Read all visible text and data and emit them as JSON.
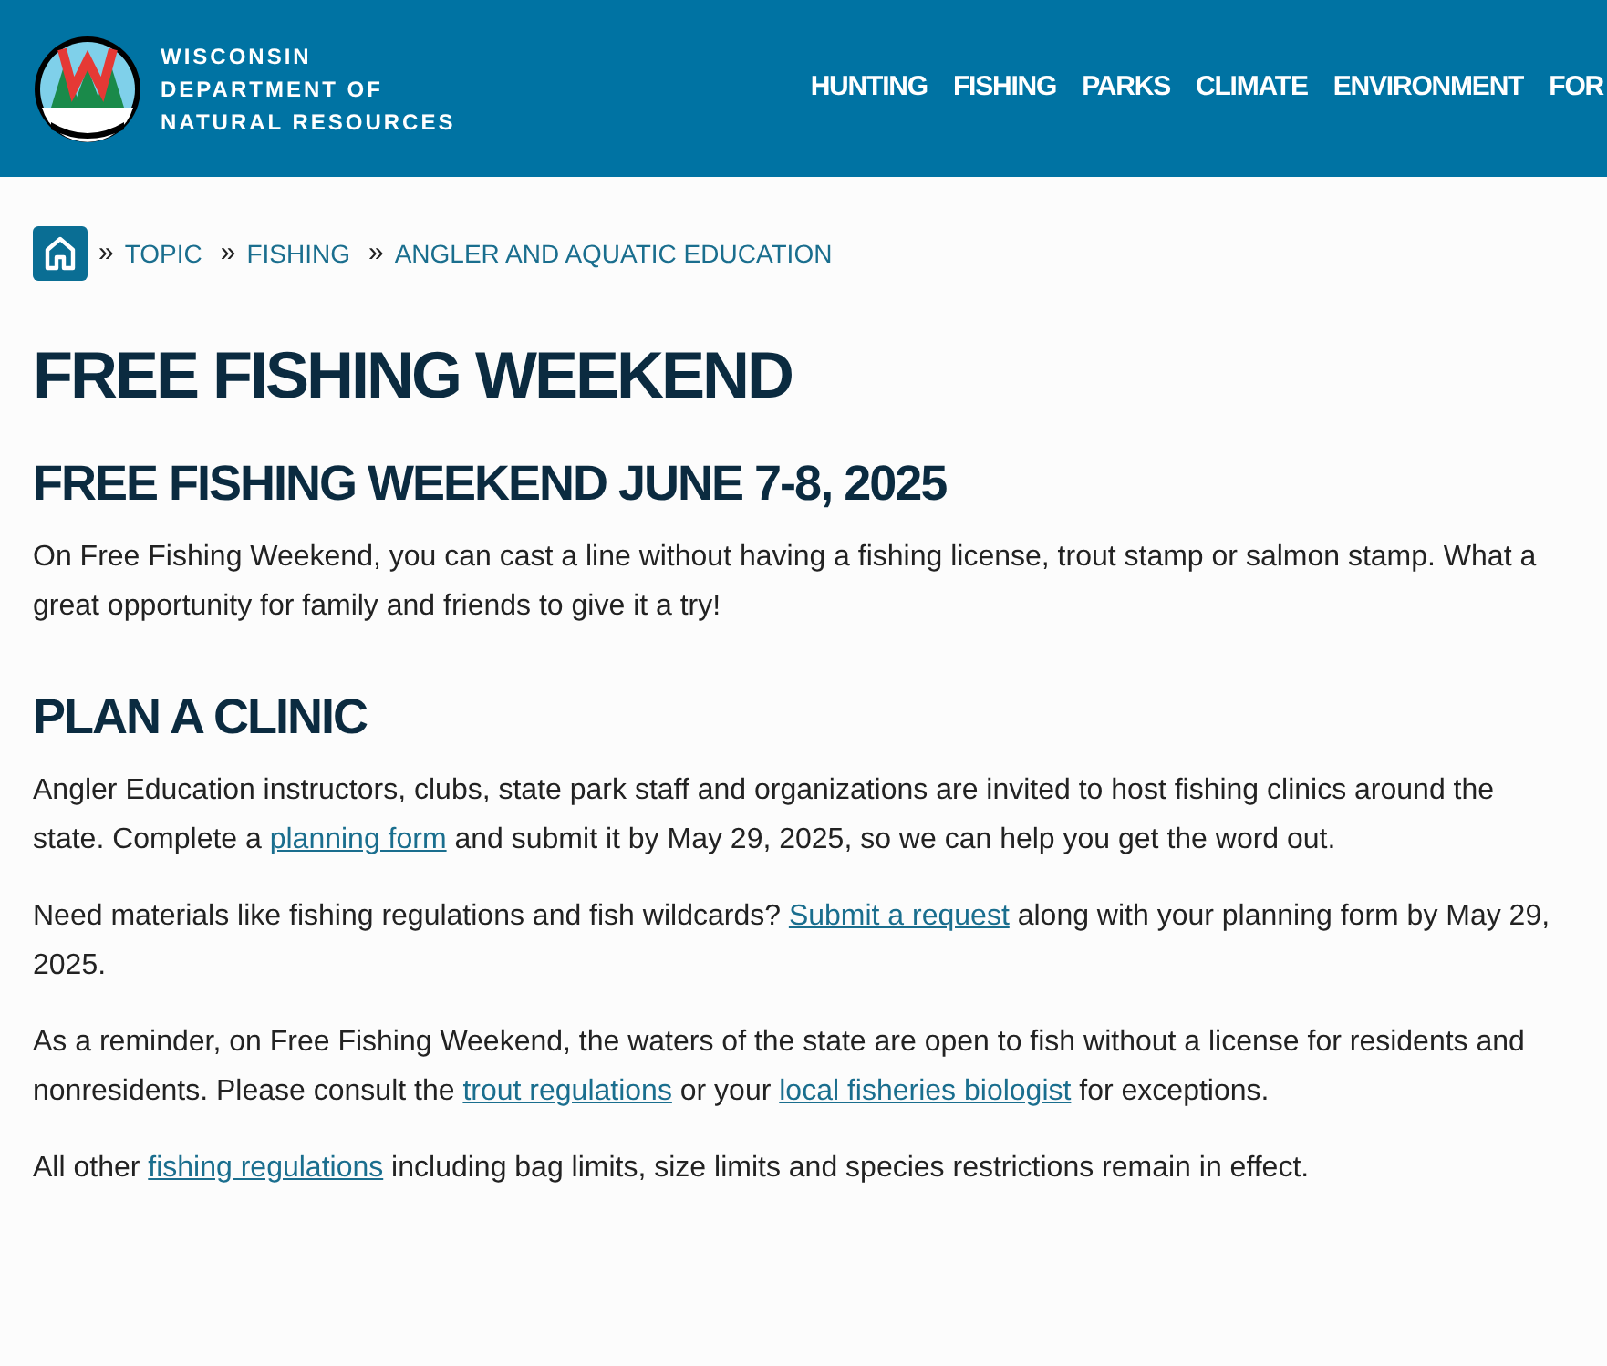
{
  "header": {
    "logo_lines": [
      "WISCONSIN",
      "DEPARTMENT OF",
      "NATURAL RESOURCES"
    ],
    "nav": [
      "HUNTING",
      "FISHING",
      "PARKS",
      "CLIMATE",
      "ENVIRONMENT",
      "FOR"
    ]
  },
  "breadcrumb": [
    "TOPIC",
    "FISHING",
    "ANGLER AND AQUATIC EDUCATION"
  ],
  "breadcrumb_separator": "»",
  "title": "FREE FISHING WEEKEND",
  "sections": [
    {
      "heading": "FREE FISHING WEEKEND JUNE 7-8, 2025",
      "paragraphs": [
        [
          {
            "kind": "text",
            "text": "On Free Fishing Weekend, you can cast a line without having a fishing license, trout stamp or salmon stamp. What a great opportunity for family and friends to give it a try!"
          }
        ]
      ]
    },
    {
      "heading": "PLAN A CLINIC",
      "paragraphs": [
        [
          {
            "kind": "text",
            "text": "Angler Education instructors, clubs, state park staff and organizations are invited to host fishing clinics around the state. Complete a "
          },
          {
            "kind": "link",
            "text": "planning form"
          },
          {
            "kind": "text",
            "text": " and submit it by May 29, 2025, so we can help you get the word out."
          }
        ],
        [
          {
            "kind": "text",
            "text": "Need materials like fishing regulations and fish wildcards? "
          },
          {
            "kind": "link",
            "text": "Submit a request"
          },
          {
            "kind": "text",
            "text": " along with your planning form by May 29, 2025."
          }
        ],
        [
          {
            "kind": "text",
            "text": "As a reminder, on Free Fishing Weekend, the waters of the state are open to fish without a license for residents and nonresidents. Please consult the "
          },
          {
            "kind": "link",
            "text": "trout regulations"
          },
          {
            "kind": "text",
            "text": " or your "
          },
          {
            "kind": "link",
            "text": "local fisheries biologist"
          },
          {
            "kind": "text",
            "text": " for exceptions."
          }
        ],
        [
          {
            "kind": "text",
            "text": "All other "
          },
          {
            "kind": "link",
            "text": "fishing regulations"
          },
          {
            "kind": "text",
            "text": " including bag limits, size limits and species restrictions remain in effect."
          }
        ]
      ]
    }
  ]
}
